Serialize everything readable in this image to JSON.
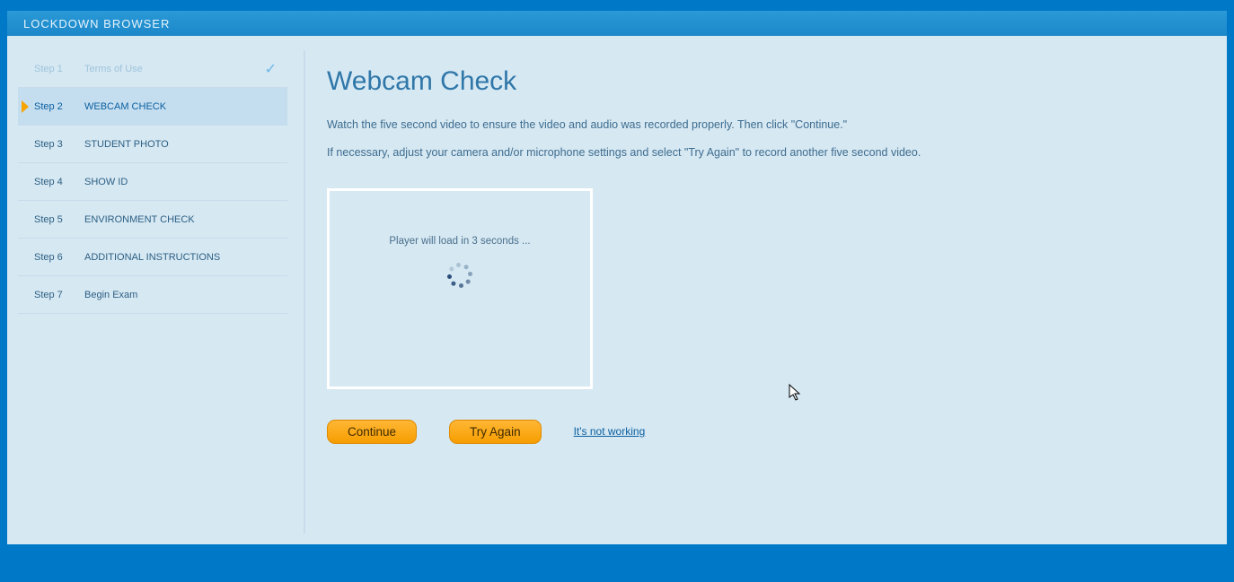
{
  "titlebar": "LOCKDOWN BROWSER",
  "sidebar": {
    "steps": [
      {
        "num": "Step 1",
        "label": "Terms of Use",
        "state": "completed"
      },
      {
        "num": "Step 2",
        "label": "WEBCAM CHECK",
        "state": "active"
      },
      {
        "num": "Step 3",
        "label": "STUDENT PHOTO",
        "state": ""
      },
      {
        "num": "Step 4",
        "label": "SHOW ID",
        "state": ""
      },
      {
        "num": "Step 5",
        "label": "ENVIRONMENT CHECK",
        "state": ""
      },
      {
        "num": "Step 6",
        "label": "ADDITIONAL INSTRUCTIONS",
        "state": ""
      },
      {
        "num": "Step 7",
        "label": "Begin Exam",
        "state": ""
      }
    ]
  },
  "main": {
    "title": "Webcam Check",
    "instruction1": "Watch the five second video to ensure the video and audio was recorded properly. Then click \"Continue.\"",
    "instruction2": "If necessary, adjust your camera and/or microphone settings and select \"Try Again\" to record another five second video.",
    "player_message": "Player will load in 3 seconds ...",
    "continue_label": "Continue",
    "try_again_label": "Try Again",
    "not_working_label": "It's not working"
  }
}
